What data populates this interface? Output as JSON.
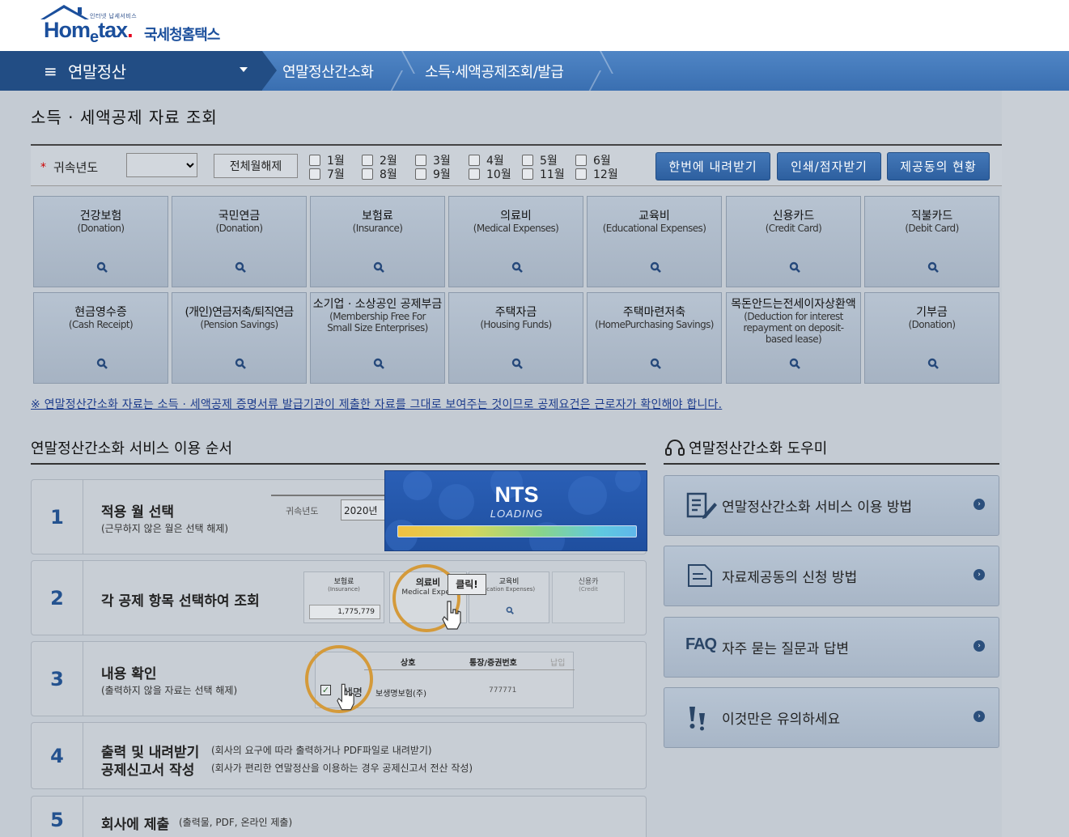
{
  "header": {
    "logo_sub": "인터넷 납세서비스",
    "logo_word_pre": "Hom",
    "logo_word_e": "e",
    "logo_word_post": "tax",
    "logo_name": "국세청홈택스"
  },
  "nav": {
    "main_label": "연말정산",
    "breadcrumbs": [
      "연말정산간소화",
      "소득·세액공제조회/발급"
    ]
  },
  "page": {
    "title": "소득 · 세액공제 자료 조회"
  },
  "filter": {
    "required_mark": "*",
    "year_label": "귀속년도",
    "year_value": "",
    "clear_button": "전체월해제",
    "months": [
      "1월",
      "2월",
      "3월",
      "4월",
      "5월",
      "6월",
      "7월",
      "8월",
      "9월",
      "10월",
      "11월",
      "12월"
    ],
    "buttons": [
      "한번에 내려받기",
      "인쇄/점자받기",
      "제공동의 현황"
    ]
  },
  "categories": [
    {
      "title": "건강보험",
      "sub": "(Donation)"
    },
    {
      "title": "국민연금",
      "sub": "(Donation)"
    },
    {
      "title": "보험료",
      "sub": "(Insurance)"
    },
    {
      "title": "의료비",
      "sub": "(Medical Expenses)"
    },
    {
      "title": "교육비",
      "sub": "(Educational Expenses)"
    },
    {
      "title": "신용카드",
      "sub": "(Credit Card)"
    },
    {
      "title": "직불카드",
      "sub": "(Debit Card)"
    },
    {
      "title": "현금영수증",
      "sub": "(Cash Receipt)"
    },
    {
      "title": "(개인)연금저축/퇴직연금",
      "sub": "(Pension Savings)"
    },
    {
      "title": "소기업 · 소상공인 공제부금",
      "sub": "(Membership Free For Small Size Enterprises)"
    },
    {
      "title": "주택자금",
      "sub": "(Housing Funds)"
    },
    {
      "title": "주택마련저축",
      "sub": "(HomePurchasing Savings)"
    },
    {
      "title": "목돈안드는전세이자상환액",
      "sub": "(Deduction for interest repayment on deposit-based lease)"
    },
    {
      "title": "기부금",
      "sub": "(Donation)"
    }
  ],
  "notice": "※ 연말정산간소화 자료는 소득 · 세액공제 증명서류 발급기관이 제출한 자료를 그대로 보여주는 것이므로 공제요건은 근로자가 확인해야 합니다.",
  "steps_section": {
    "title": "연말정산간소화 서비스 이용 순서",
    "steps": [
      {
        "num": "1",
        "title": "적용 월 선택",
        "desc": "(근무하지 않은 월은 선택 해제)"
      },
      {
        "num": "2",
        "title": "각 공제 항목 선택하여 조회",
        "desc": ""
      },
      {
        "num": "3",
        "title": "내용 확인",
        "desc": "(출력하지 않을 자료는 선택 해제)"
      },
      {
        "num": "4",
        "title": "출력 및 내려받기",
        "title2": "공제신고서 작성",
        "desc": "(회사의 요구에 따라 출력하거나 PDF파일로 내려받기)",
        "desc2": "(회사가 편리한 연말정산을 이용하는 경우 공제신고서 전산 작성)"
      },
      {
        "num": "5",
        "title": "회사에 제출",
        "desc": "(출력물, PDF, 온라인 제출)"
      }
    ],
    "illus": {
      "s1_label": "귀속년도",
      "s1_value": "2020년",
      "s2_items": [
        "보험료",
        "의료비",
        "교육비",
        "신용카"
      ],
      "s2_subs": [
        "(Insurance)",
        "Medical Expen",
        "ucation Expenses)",
        "(Credit"
      ],
      "s2_amount": "1,775,779",
      "s2_click": "클릭!",
      "s3_cols": [
        "상호",
        "통장/증권번호",
        "납입"
      ],
      "s3_row_name": "생명",
      "s3_row_company": "보생명보험(주)",
      "s3_row_no": "777771"
    }
  },
  "loading": {
    "brand": "NTS",
    "text": "LOADING",
    "progress": 1.0
  },
  "helper": {
    "title": "연말정산간소화 도우미",
    "items": [
      {
        "icon": "document-pen-icon",
        "label": "연말정산간소화 서비스 이용 방법"
      },
      {
        "icon": "document-icon",
        "label": "자료제공동의 신청 방법"
      },
      {
        "icon": "faq-icon",
        "prefix": "FAQ",
        "label": "자주 묻는 질문과 답변"
      },
      {
        "icon": "exclamation-icon",
        "label": "이것만은 유의하세요"
      }
    ]
  }
}
